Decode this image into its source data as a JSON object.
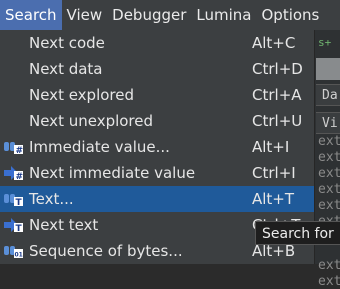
{
  "menubar": {
    "items": [
      {
        "label": "Search"
      },
      {
        "label": "View"
      },
      {
        "label": "Debugger"
      },
      {
        "label": "Lumina"
      },
      {
        "label": "Options"
      }
    ]
  },
  "menu": {
    "items": [
      {
        "label": "Next code",
        "shortcut": "Alt+C",
        "icon": ""
      },
      {
        "label": "Next data",
        "shortcut": "Ctrl+D",
        "icon": ""
      },
      {
        "label": "Next explored",
        "shortcut": "Ctrl+A",
        "icon": ""
      },
      {
        "label": "Next unexplored",
        "shortcut": "Ctrl+U",
        "icon": ""
      },
      {
        "label": "Immediate value...",
        "shortcut": "Alt+I",
        "icon": "binoculars-hash-icon"
      },
      {
        "label": "Next immediate value",
        "shortcut": "Ctrl+I",
        "icon": "arrow-hash-icon"
      },
      {
        "label": "Text...",
        "shortcut": "Alt+T",
        "icon": "binoculars-text-icon",
        "highlighted": true
      },
      {
        "label": "Next text",
        "shortcut": "Ctrl+T",
        "icon": "arrow-text-icon"
      },
      {
        "label": "Sequence of bytes...",
        "shortcut": "Alt+B",
        "icon": "binoculars-bytes-icon"
      }
    ]
  },
  "background": {
    "header_text": "Da",
    "row_text": "Vi",
    "lines": [
      "ext",
      "ext",
      "ext",
      "ext",
      "ext",
      "ext",
      "ext",
      "ext",
      "ext"
    ]
  },
  "tooltip": {
    "text": "Search for"
  },
  "colors": {
    "menu_bg": "#3c3f41",
    "highlight": "#1f5a9a",
    "active_menu": "#4b6eaf"
  }
}
